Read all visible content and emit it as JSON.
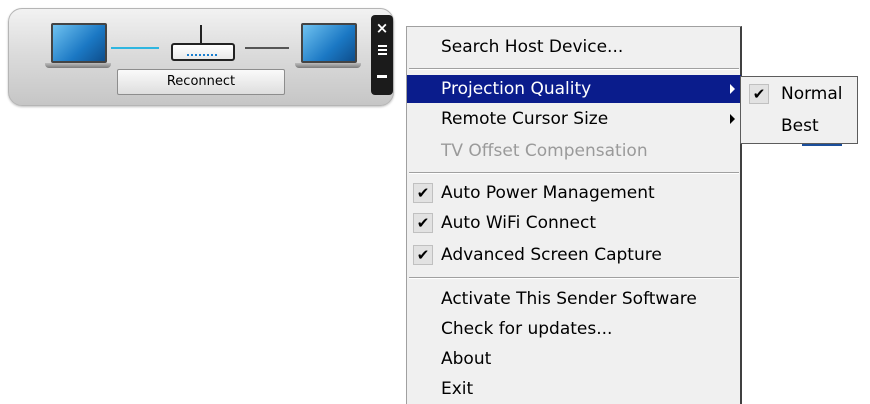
{
  "widget": {
    "reconnect_label": "Reconnect",
    "controls": {
      "close_glyph": "×",
      "menu_icon": "hamburger-menu-icon",
      "minimize_icon": "minimize-icon"
    },
    "colors": {
      "link_line": "#2fb6e0",
      "link_line_right": "#555555"
    }
  },
  "context_menu": {
    "items": [
      {
        "label": "Search Host Device...",
        "checked": false,
        "submenu": false,
        "disabled": false
      },
      {
        "label": "Projection Quality",
        "checked": false,
        "submenu": true,
        "disabled": false,
        "highlighted": true
      },
      {
        "label": "Remote Cursor Size",
        "checked": false,
        "submenu": true,
        "disabled": false
      },
      {
        "label": "TV Offset Compensation",
        "checked": false,
        "submenu": false,
        "disabled": true
      },
      {
        "label": "Auto Power Management",
        "checked": true,
        "submenu": false,
        "disabled": false
      },
      {
        "label": "Auto WiFi Connect",
        "checked": true,
        "submenu": false,
        "disabled": false
      },
      {
        "label": "Advanced Screen Capture",
        "checked": true,
        "submenu": false,
        "disabled": false
      },
      {
        "label": "Activate This Sender Software",
        "checked": false,
        "submenu": false,
        "disabled": false
      },
      {
        "label": "Check for updates...",
        "checked": false,
        "submenu": false,
        "disabled": false
      },
      {
        "label": "About",
        "checked": false,
        "submenu": false,
        "disabled": false
      },
      {
        "label": "Exit",
        "checked": false,
        "submenu": false,
        "disabled": false
      }
    ],
    "check_glyph": "✔",
    "highlight_color": "#0a1c8c"
  },
  "submenu": {
    "items": [
      {
        "label": "Normal",
        "checked": true
      },
      {
        "label": "Best",
        "checked": false
      }
    ]
  }
}
